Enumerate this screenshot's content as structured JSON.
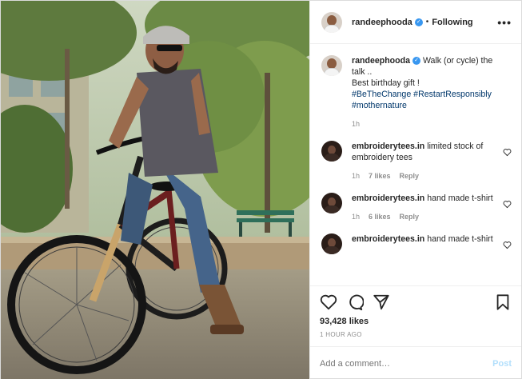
{
  "header": {
    "username": "randeephooda",
    "separator": "•",
    "follow_state": "Following",
    "more_label": "•••"
  },
  "caption": {
    "username": "randeephooda",
    "text_line1": "Walk (or cycle) the talk ..",
    "text_line2": "Best birthday gift !",
    "hashtag1": "#BeTheChange",
    "hashtag2": "#RestartResponsibly",
    "hashtag3": "#mothernature",
    "age": "1h"
  },
  "comments": [
    {
      "username": "embroiderytees.in",
      "text": "limited stock of embroidery tees",
      "age": "1h",
      "likes": "7 likes",
      "reply": "Reply"
    },
    {
      "username": "embroiderytees.in",
      "text": "hand made t-shirt",
      "age": "1h",
      "likes": "6 likes",
      "reply": "Reply"
    },
    {
      "username": "embroiderytees.in",
      "text": "hand made t-shirt",
      "age": "",
      "likes": "",
      "reply": ""
    }
  ],
  "engagement": {
    "likes": "93,428 likes",
    "posted": "1 HOUR AGO"
  },
  "composer": {
    "placeholder": "Add a comment…",
    "post_label": "Post"
  },
  "icons": [
    "heart-icon",
    "comment-icon",
    "share-icon",
    "bookmark-icon",
    "verified-badge-icon",
    "more-options-icon"
  ]
}
